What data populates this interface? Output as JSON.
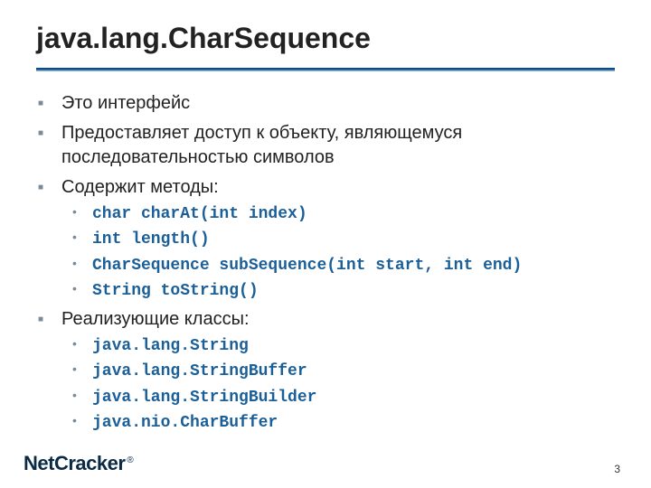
{
  "title": "java.lang.CharSequence",
  "bullets": {
    "b1": "Это интерфейс",
    "b2": "Предоставляет доступ к объекту, являющемуся последовательностью символов",
    "b3": "Содержит методы:",
    "b3_sub": {
      "s1": "char charAt(int index)",
      "s2": "int length()",
      "s3": "CharSequence subSequence(int start, int end)",
      "s4": "String toString()"
    },
    "b4": "Реализующие классы:",
    "b4_sub": {
      "s1": "java.lang.String",
      "s2": "java.lang.StringBuffer",
      "s3": "java.lang.StringBuilder",
      "s4": "java.nio.CharBuffer"
    }
  },
  "footer": {
    "brand": "NetCracker",
    "reg": "®"
  },
  "page_number": "3"
}
